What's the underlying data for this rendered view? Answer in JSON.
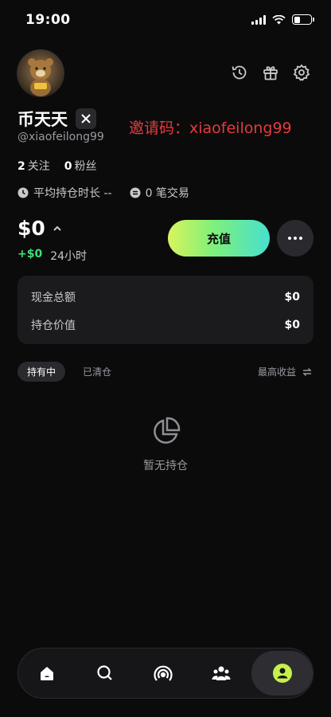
{
  "status_bar": {
    "time": "19:00"
  },
  "profile": {
    "display_name": "币天天",
    "handle": "@xiaofeilong99",
    "invite_text": "邀请码：xiaofeilong99",
    "following_count": "2",
    "following_label": "关注",
    "followers_count": "0",
    "followers_label": "粉丝",
    "avg_hold_label": "平均持仓时长 --",
    "trades_label": "0 笔交易"
  },
  "account": {
    "balance": "$0",
    "pnl": "+$0",
    "pnl_period": "24小时",
    "deposit_label": "充值"
  },
  "summary": {
    "rows": [
      {
        "label": "现金总额",
        "value": "$0"
      },
      {
        "label": "持仓价值",
        "value": "$0"
      }
    ]
  },
  "holdings": {
    "tabs": [
      "持有中",
      "已清仓"
    ],
    "active_tab": "持有中",
    "sort_label": "最高收益",
    "empty_text": "暂无持仓"
  },
  "nav": {
    "items": [
      "home-icon",
      "search-icon",
      "signal-icon",
      "community-icon",
      "profile-icon"
    ],
    "active": "profile-icon",
    "accent": "#c8f04a"
  },
  "colors": {
    "background": "#0b0b0c",
    "invite_red": "#e53b3b",
    "positive_green": "#3fe07a"
  }
}
